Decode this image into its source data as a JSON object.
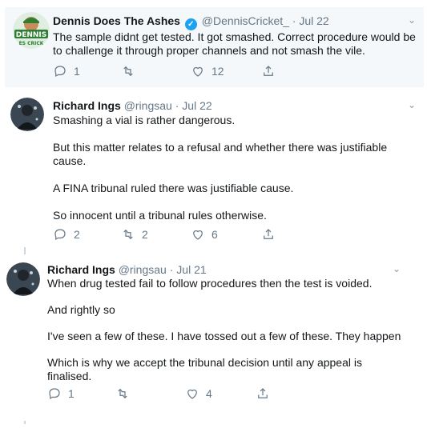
{
  "tweets": [
    {
      "display_name": "Dennis Does The Ashes",
      "handle": "@DennisCricket_",
      "sep": "·",
      "date": "Jul 22",
      "avatar_text": "DENNIS",
      "avatar_subtext": "ES CRICK",
      "verified": true,
      "paragraphs": [
        "The sample didnt get tested. It got smashed. Correct procedure would be to challenge it through proper channels and not smash the vile."
      ],
      "replies": "1",
      "retweets": "",
      "likes": "12"
    },
    {
      "display_name": "Richard Ings",
      "handle": "@ringsau",
      "sep": "·",
      "date": "Jul 22",
      "verified": false,
      "paragraphs": [
        "Smashing a vial is rather dangerous.",
        "But this matter relates to a refusal and whether there was justifiable cause.",
        "A FINA tribunal ruled there was justifiable cause.",
        "So innocent until a tribunal rules otherwise."
      ],
      "replies": "2",
      "retweets": "2",
      "likes": "6"
    },
    {
      "display_name": "Richard Ings",
      "handle": "@ringsau",
      "sep": "·",
      "date": "Jul 21",
      "verified": false,
      "paragraphs": [
        "When drug tested fail to follow procedures then the test is voided.",
        "And rightly so",
        "I've seen a few of these. I have tossed out a few of these. They happen",
        "Which is why we accept the tribunal decision until any appeal is finalised."
      ],
      "replies": "1",
      "retweets": "",
      "likes": "4"
    }
  ],
  "icons": {
    "reply": "reply-icon",
    "retweet": "retweet-icon",
    "like": "heart-icon",
    "share": "share-icon",
    "more": "chevron-down-icon",
    "verified": "verified-badge-icon"
  },
  "colors": {
    "accent": "#1da1f2",
    "muted": "#657786",
    "highlight_bg": "#f5f8fa",
    "thread_line": "#ccd6dd",
    "avatar_green": "#2e7d32"
  }
}
